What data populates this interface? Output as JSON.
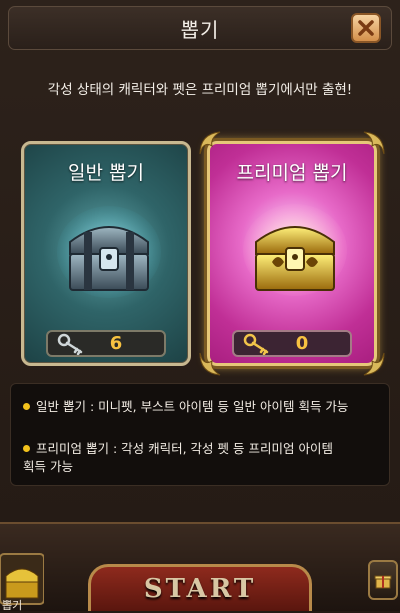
{
  "header": {
    "title": "뽑기"
  },
  "subtitle": "각성 상태의 캐릭터와 펫은 프리미엄 뽑기에서만 출현!",
  "cards": {
    "normal": {
      "title": "일반 뽑기",
      "key_count": "6"
    },
    "premium": {
      "title": "프리미엄 뽑기",
      "key_count": "0"
    }
  },
  "info": {
    "item1": "일반 뽑기 : 미니펫, 부스트 아이템 등 일반 아이템 획득 가능",
    "item2_line1": "프리미엄 뽑기 : 각성 캐릭터, 각성 펫 등 프리미엄 아이템",
    "item2_line2": "획득 가능"
  },
  "bottom": {
    "start_label": "START",
    "gacha_label": "뽑기"
  },
  "colors": {
    "bullet": "#f3c21c",
    "key_count": "#f7c241",
    "premium_card": "#c02f96",
    "normal_card": "#2f6468"
  },
  "icons": {
    "close": "close-icon",
    "key_silver": "silver-key-icon",
    "key_gold": "gold-key-icon",
    "gift": "gift-icon"
  }
}
